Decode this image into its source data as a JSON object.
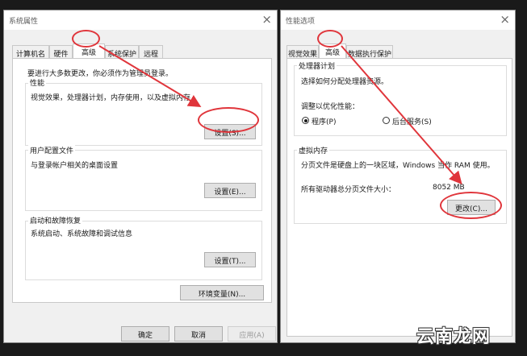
{
  "left_window": {
    "title": "系统属性",
    "close_glyph": "×",
    "tabs": [
      "计算机名",
      "硬件",
      "高级",
      "系统保护",
      "远程"
    ],
    "admin_note": "要进行大多数更改，你必须作为管理员登录。",
    "performance": {
      "title": "性能",
      "desc": "视觉效果，处理器计划，内存使用，以及虚拟内存",
      "button": "设置(S)..."
    },
    "user_profile": {
      "title": "用户配置文件",
      "desc": "与登录帐户相关的桌面设置",
      "button": "设置(E)..."
    },
    "startup_recovery": {
      "title": "启动和故障恢复",
      "desc": "系统启动、系统故障和调试信息",
      "button": "设置(T)..."
    },
    "env_button": "环境变量(N)...",
    "ok_button": "确定",
    "cancel_button": "取消",
    "apply_button": "应用(A)"
  },
  "right_window": {
    "title": "性能选项",
    "close_glyph": "×",
    "tabs": [
      "视觉效果",
      "高级",
      "数据执行保护"
    ],
    "processor": {
      "title": "处理器计划",
      "desc": "选择如何分配处理器资源。",
      "adjust_label": "调整以优化性能：",
      "options": [
        "程序(P)",
        "后台服务(S)"
      ],
      "selected": "程序(P)"
    },
    "virtual_memory": {
      "title": "虚拟内存",
      "desc": "分页文件是硬盘上的一块区域，Windows 当作 RAM 使用。",
      "total_label": "所有驱动器总分页文件大小：",
      "total_value": "8052 MB",
      "button": "更改(C)..."
    }
  },
  "watermark": "云南龙网",
  "colors": {
    "annotation": "#e0353b",
    "window_bg": "#f0f0f0",
    "panel_bg": "#ffffff"
  },
  "icons": [
    "close-icon",
    "radio-icon",
    "annotation-arrow-icon",
    "annotation-circle-icon"
  ]
}
